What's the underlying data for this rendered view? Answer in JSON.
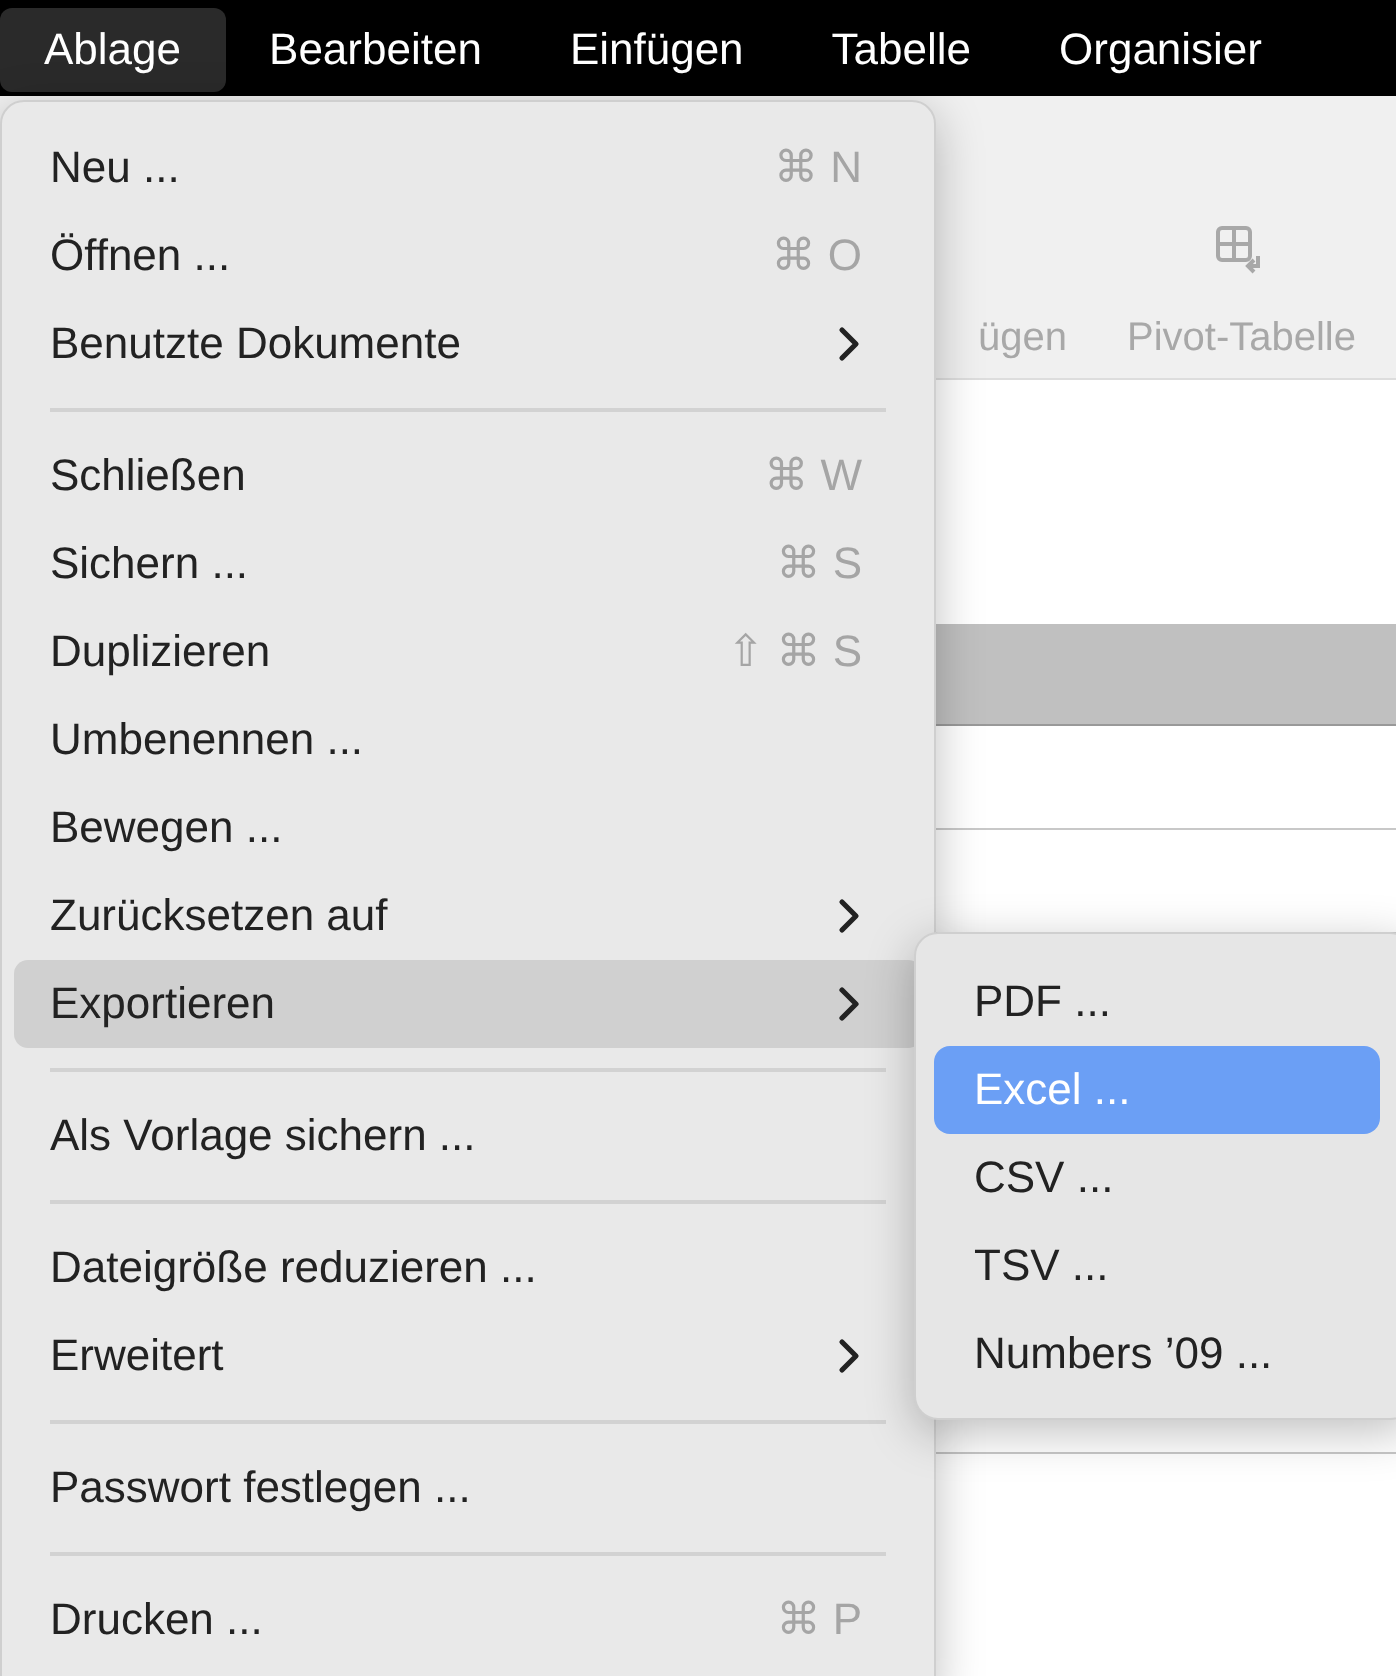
{
  "menubar": [
    {
      "label": "Ablage",
      "selected": true
    },
    {
      "label": "Bearbeiten",
      "selected": false
    },
    {
      "label": "Einfügen",
      "selected": false
    },
    {
      "label": "Tabelle",
      "selected": false
    },
    {
      "label": "Organisier",
      "selected": false
    }
  ],
  "toolbar": [
    {
      "label": "ügen",
      "icon": false
    },
    {
      "label": "Pivot-Tabelle",
      "icon": true
    }
  ],
  "menu": {
    "groups": [
      [
        {
          "label": "Neu ...",
          "shortcut": "⌘ N",
          "submenu": false,
          "selected": false
        },
        {
          "label": "Öffnen ...",
          "shortcut": "⌘ O",
          "submenu": false,
          "selected": false
        },
        {
          "label": "Benutzte Dokumente",
          "submenu": true,
          "selected": false
        }
      ],
      [
        {
          "label": "Schließen",
          "shortcut": "⌘ W",
          "submenu": false,
          "selected": false
        },
        {
          "label": "Sichern ...",
          "shortcut": "⌘ S",
          "submenu": false,
          "selected": false
        },
        {
          "label": "Duplizieren",
          "shortcut": "⇧ ⌘ S",
          "submenu": false,
          "selected": false
        },
        {
          "label": "Umbenennen ...",
          "submenu": false,
          "selected": false
        },
        {
          "label": "Bewegen ...",
          "submenu": false,
          "selected": false
        },
        {
          "label": "Zurücksetzen auf",
          "submenu": true,
          "selected": false
        },
        {
          "label": "Exportieren",
          "submenu": true,
          "selected": true
        }
      ],
      [
        {
          "label": "Als Vorlage sichern ...",
          "submenu": false,
          "selected": false
        }
      ],
      [
        {
          "label": "Dateigröße reduzieren ...",
          "submenu": false,
          "selected": false
        },
        {
          "label": "Erweitert",
          "submenu": true,
          "selected": false
        }
      ],
      [
        {
          "label": "Passwort festlegen ...",
          "submenu": false,
          "selected": false
        }
      ],
      [
        {
          "label": "Drucken ...",
          "shortcut": "⌘ P",
          "submenu": false,
          "selected": false
        }
      ]
    ]
  },
  "submenu": [
    {
      "label": "PDF ...",
      "selected": false
    },
    {
      "label": "Excel ...",
      "selected": true
    },
    {
      "label": "CSV ...",
      "selected": false
    },
    {
      "label": "TSV ...",
      "selected": false
    },
    {
      "label": "Numbers ’09 ...",
      "selected": false
    }
  ]
}
